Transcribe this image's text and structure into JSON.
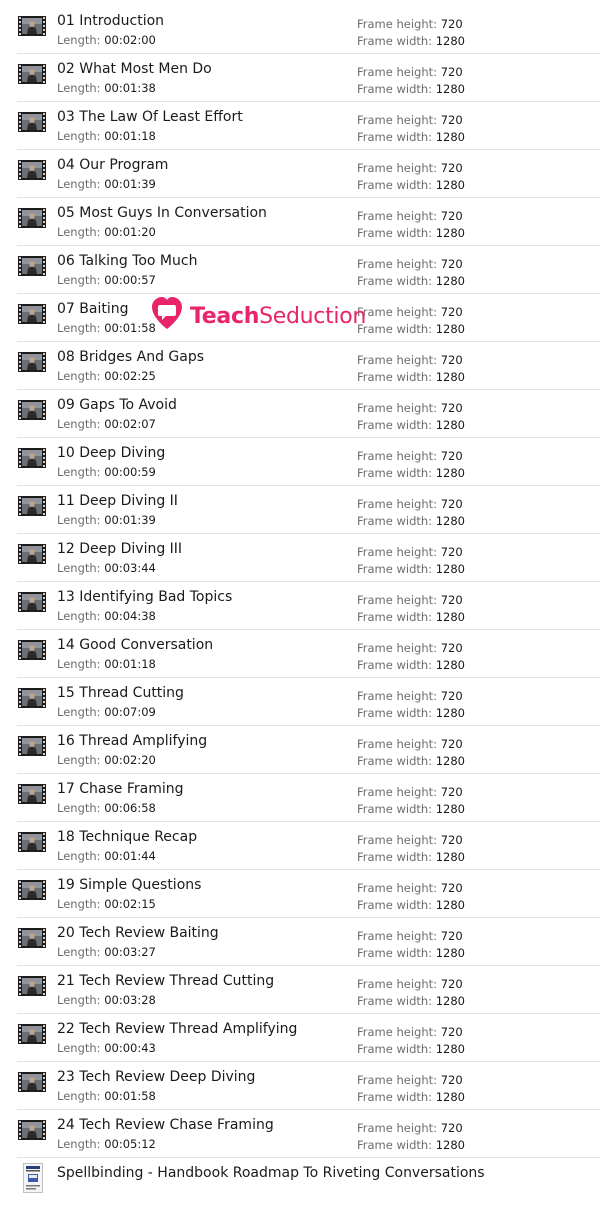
{
  "labels": {
    "length": "Length:",
    "frame_height": "Frame height:",
    "frame_width": "Frame width:"
  },
  "videos": [
    {
      "title": "01 Introduction",
      "length": "00:02:00",
      "frame_height": "720",
      "frame_width": "1280"
    },
    {
      "title": "02 What Most Men Do",
      "length": "00:01:38",
      "frame_height": "720",
      "frame_width": "1280"
    },
    {
      "title": "03 The Law Of Least Effort",
      "length": "00:01:18",
      "frame_height": "720",
      "frame_width": "1280"
    },
    {
      "title": "04 Our Program",
      "length": "00:01:39",
      "frame_height": "720",
      "frame_width": "1280"
    },
    {
      "title": "05 Most Guys In Conversation",
      "length": "00:01:20",
      "frame_height": "720",
      "frame_width": "1280"
    },
    {
      "title": "06 Talking Too Much",
      "length": "00:00:57",
      "frame_height": "720",
      "frame_width": "1280"
    },
    {
      "title": "07 Baiting",
      "length": "00:01:58",
      "frame_height": "720",
      "frame_width": "1280"
    },
    {
      "title": "08 Bridges And Gaps",
      "length": "00:02:25",
      "frame_height": "720",
      "frame_width": "1280"
    },
    {
      "title": "09 Gaps To Avoid",
      "length": "00:02:07",
      "frame_height": "720",
      "frame_width": "1280"
    },
    {
      "title": "10 Deep Diving",
      "length": "00:00:59",
      "frame_height": "720",
      "frame_width": "1280"
    },
    {
      "title": "11 Deep Diving II",
      "length": "00:01:39",
      "frame_height": "720",
      "frame_width": "1280"
    },
    {
      "title": "12 Deep Diving III",
      "length": "00:03:44",
      "frame_height": "720",
      "frame_width": "1280"
    },
    {
      "title": "13 Identifying Bad Topics",
      "length": "00:04:38",
      "frame_height": "720",
      "frame_width": "1280"
    },
    {
      "title": "14 Good Conversation",
      "length": "00:01:18",
      "frame_height": "720",
      "frame_width": "1280"
    },
    {
      "title": "15 Thread Cutting",
      "length": "00:07:09",
      "frame_height": "720",
      "frame_width": "1280"
    },
    {
      "title": "16 Thread Amplifying",
      "length": "00:02:20",
      "frame_height": "720",
      "frame_width": "1280"
    },
    {
      "title": "17 Chase Framing",
      "length": "00:06:58",
      "frame_height": "720",
      "frame_width": "1280"
    },
    {
      "title": "18 Technique Recap",
      "length": "00:01:44",
      "frame_height": "720",
      "frame_width": "1280"
    },
    {
      "title": "19 Simple Questions",
      "length": "00:02:15",
      "frame_height": "720",
      "frame_width": "1280"
    },
    {
      "title": "20 Tech Review Baiting",
      "length": "00:03:27",
      "frame_height": "720",
      "frame_width": "1280"
    },
    {
      "title": "21 Tech Review Thread Cutting",
      "length": "00:03:28",
      "frame_height": "720",
      "frame_width": "1280"
    },
    {
      "title": "22 Tech Review Thread Amplifying",
      "length": "00:00:43",
      "frame_height": "720",
      "frame_width": "1280"
    },
    {
      "title": "23 Tech Review Deep Diving",
      "length": "00:01:58",
      "frame_height": "720",
      "frame_width": "1280"
    },
    {
      "title": "24 Tech Review Chase Framing",
      "length": "00:05:12",
      "frame_height": "720",
      "frame_width": "1280"
    }
  ],
  "document": {
    "title": "Spellbinding - Handbook Roadmap To Riveting Conversations",
    "icon": "book-cover-icon"
  },
  "watermark": {
    "text_bold": "Teach",
    "text_regular": "Seduction",
    "icon": "heart-chat-icon",
    "color": "#e8246b"
  }
}
